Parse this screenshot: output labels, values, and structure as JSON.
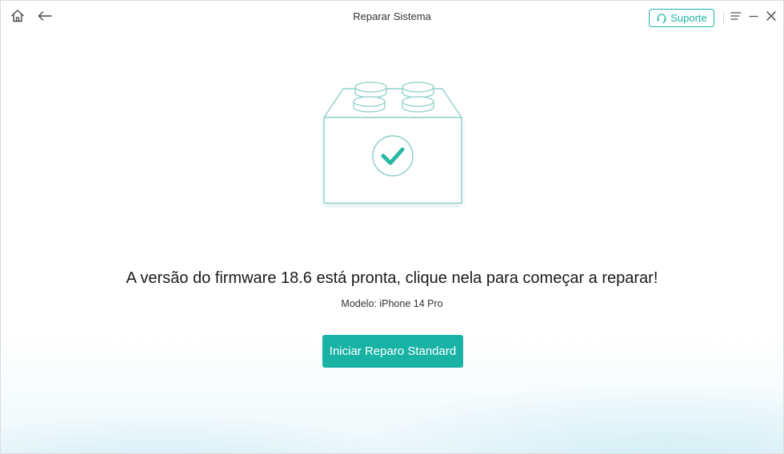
{
  "window": {
    "title": "Reparar Sistema"
  },
  "toolbar": {
    "home_icon": "home-icon",
    "back_icon": "arrow-left-icon",
    "support_label": "Suporte",
    "support_icon": "headset-icon",
    "menu_icon": "menu-icon",
    "minimize_icon": "minimize-icon",
    "close_icon": "close-icon"
  },
  "main": {
    "illustration_icon": "firmware-block-check-icon",
    "message": "A versão do firmware 18.6 está pronta, clique nela para começar a reparar!",
    "model": "Modelo: iPhone 14 Pro",
    "start_button_label": "Iniciar Reparo Standard"
  },
  "colors": {
    "accent": "#19b3a6",
    "illustration_line": "#8fd0c9",
    "check_green": "#2bb8a4"
  }
}
